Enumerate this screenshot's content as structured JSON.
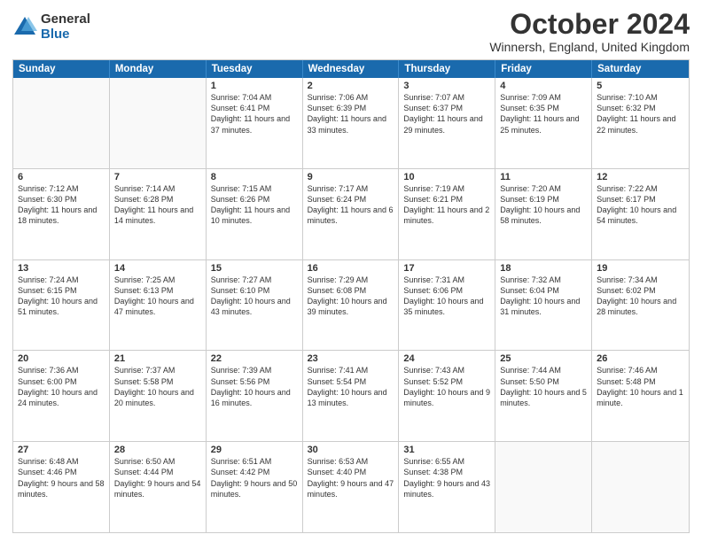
{
  "logo": {
    "general": "General",
    "blue": "Blue"
  },
  "title": "October 2024",
  "location": "Winnersh, England, United Kingdom",
  "days_of_week": [
    "Sunday",
    "Monday",
    "Tuesday",
    "Wednesday",
    "Thursday",
    "Friday",
    "Saturday"
  ],
  "weeks": [
    [
      {
        "day": "",
        "empty": true
      },
      {
        "day": "",
        "empty": true
      },
      {
        "day": "1",
        "sunrise": "Sunrise: 7:04 AM",
        "sunset": "Sunset: 6:41 PM",
        "daylight": "Daylight: 11 hours and 37 minutes."
      },
      {
        "day": "2",
        "sunrise": "Sunrise: 7:06 AM",
        "sunset": "Sunset: 6:39 PM",
        "daylight": "Daylight: 11 hours and 33 minutes."
      },
      {
        "day": "3",
        "sunrise": "Sunrise: 7:07 AM",
        "sunset": "Sunset: 6:37 PM",
        "daylight": "Daylight: 11 hours and 29 minutes."
      },
      {
        "day": "4",
        "sunrise": "Sunrise: 7:09 AM",
        "sunset": "Sunset: 6:35 PM",
        "daylight": "Daylight: 11 hours and 25 minutes."
      },
      {
        "day": "5",
        "sunrise": "Sunrise: 7:10 AM",
        "sunset": "Sunset: 6:32 PM",
        "daylight": "Daylight: 11 hours and 22 minutes."
      }
    ],
    [
      {
        "day": "6",
        "sunrise": "Sunrise: 7:12 AM",
        "sunset": "Sunset: 6:30 PM",
        "daylight": "Daylight: 11 hours and 18 minutes."
      },
      {
        "day": "7",
        "sunrise": "Sunrise: 7:14 AM",
        "sunset": "Sunset: 6:28 PM",
        "daylight": "Daylight: 11 hours and 14 minutes."
      },
      {
        "day": "8",
        "sunrise": "Sunrise: 7:15 AM",
        "sunset": "Sunset: 6:26 PM",
        "daylight": "Daylight: 11 hours and 10 minutes."
      },
      {
        "day": "9",
        "sunrise": "Sunrise: 7:17 AM",
        "sunset": "Sunset: 6:24 PM",
        "daylight": "Daylight: 11 hours and 6 minutes."
      },
      {
        "day": "10",
        "sunrise": "Sunrise: 7:19 AM",
        "sunset": "Sunset: 6:21 PM",
        "daylight": "Daylight: 11 hours and 2 minutes."
      },
      {
        "day": "11",
        "sunrise": "Sunrise: 7:20 AM",
        "sunset": "Sunset: 6:19 PM",
        "daylight": "Daylight: 10 hours and 58 minutes."
      },
      {
        "day": "12",
        "sunrise": "Sunrise: 7:22 AM",
        "sunset": "Sunset: 6:17 PM",
        "daylight": "Daylight: 10 hours and 54 minutes."
      }
    ],
    [
      {
        "day": "13",
        "sunrise": "Sunrise: 7:24 AM",
        "sunset": "Sunset: 6:15 PM",
        "daylight": "Daylight: 10 hours and 51 minutes."
      },
      {
        "day": "14",
        "sunrise": "Sunrise: 7:25 AM",
        "sunset": "Sunset: 6:13 PM",
        "daylight": "Daylight: 10 hours and 47 minutes."
      },
      {
        "day": "15",
        "sunrise": "Sunrise: 7:27 AM",
        "sunset": "Sunset: 6:10 PM",
        "daylight": "Daylight: 10 hours and 43 minutes."
      },
      {
        "day": "16",
        "sunrise": "Sunrise: 7:29 AM",
        "sunset": "Sunset: 6:08 PM",
        "daylight": "Daylight: 10 hours and 39 minutes."
      },
      {
        "day": "17",
        "sunrise": "Sunrise: 7:31 AM",
        "sunset": "Sunset: 6:06 PM",
        "daylight": "Daylight: 10 hours and 35 minutes."
      },
      {
        "day": "18",
        "sunrise": "Sunrise: 7:32 AM",
        "sunset": "Sunset: 6:04 PM",
        "daylight": "Daylight: 10 hours and 31 minutes."
      },
      {
        "day": "19",
        "sunrise": "Sunrise: 7:34 AM",
        "sunset": "Sunset: 6:02 PM",
        "daylight": "Daylight: 10 hours and 28 minutes."
      }
    ],
    [
      {
        "day": "20",
        "sunrise": "Sunrise: 7:36 AM",
        "sunset": "Sunset: 6:00 PM",
        "daylight": "Daylight: 10 hours and 24 minutes."
      },
      {
        "day": "21",
        "sunrise": "Sunrise: 7:37 AM",
        "sunset": "Sunset: 5:58 PM",
        "daylight": "Daylight: 10 hours and 20 minutes."
      },
      {
        "day": "22",
        "sunrise": "Sunrise: 7:39 AM",
        "sunset": "Sunset: 5:56 PM",
        "daylight": "Daylight: 10 hours and 16 minutes."
      },
      {
        "day": "23",
        "sunrise": "Sunrise: 7:41 AM",
        "sunset": "Sunset: 5:54 PM",
        "daylight": "Daylight: 10 hours and 13 minutes."
      },
      {
        "day": "24",
        "sunrise": "Sunrise: 7:43 AM",
        "sunset": "Sunset: 5:52 PM",
        "daylight": "Daylight: 10 hours and 9 minutes."
      },
      {
        "day": "25",
        "sunrise": "Sunrise: 7:44 AM",
        "sunset": "Sunset: 5:50 PM",
        "daylight": "Daylight: 10 hours and 5 minutes."
      },
      {
        "day": "26",
        "sunrise": "Sunrise: 7:46 AM",
        "sunset": "Sunset: 5:48 PM",
        "daylight": "Daylight: 10 hours and 1 minute."
      }
    ],
    [
      {
        "day": "27",
        "sunrise": "Sunrise: 6:48 AM",
        "sunset": "Sunset: 4:46 PM",
        "daylight": "Daylight: 9 hours and 58 minutes."
      },
      {
        "day": "28",
        "sunrise": "Sunrise: 6:50 AM",
        "sunset": "Sunset: 4:44 PM",
        "daylight": "Daylight: 9 hours and 54 minutes."
      },
      {
        "day": "29",
        "sunrise": "Sunrise: 6:51 AM",
        "sunset": "Sunset: 4:42 PM",
        "daylight": "Daylight: 9 hours and 50 minutes."
      },
      {
        "day": "30",
        "sunrise": "Sunrise: 6:53 AM",
        "sunset": "Sunset: 4:40 PM",
        "daylight": "Daylight: 9 hours and 47 minutes."
      },
      {
        "day": "31",
        "sunrise": "Sunrise: 6:55 AM",
        "sunset": "Sunset: 4:38 PM",
        "daylight": "Daylight: 9 hours and 43 minutes."
      },
      {
        "day": "",
        "empty": true
      },
      {
        "day": "",
        "empty": true
      }
    ]
  ]
}
